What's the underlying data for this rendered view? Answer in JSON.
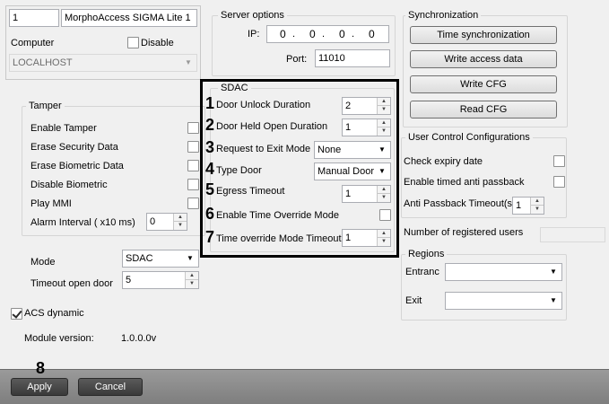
{
  "device": {
    "number": "1",
    "name": "MorphoAccess SIGMA Lite 1",
    "computer_label": "Computer",
    "disable_label": "Disable",
    "computer_value": "LOCALHOST"
  },
  "server": {
    "title": "Server options",
    "ip_label": "IP:",
    "ip_octets": [
      "0",
      "0",
      "0",
      "0"
    ],
    "port_label": "Port:",
    "port_value": "11010"
  },
  "sync": {
    "title": "Synchronization",
    "buttons": [
      "Time synchronization",
      "Write access data",
      "Write CFG",
      "Read CFG"
    ]
  },
  "tamper": {
    "title": "Tamper",
    "items": [
      "Enable Tamper",
      "Erase Security Data",
      "Erase Biometric Data",
      "Disable Biometric",
      "Play MMI"
    ],
    "alarm_label": "Alarm Interval ( x10 ms)",
    "alarm_value": "0"
  },
  "sdac": {
    "title": "SDAC",
    "door_unlock_label": "Door Unlock Duration",
    "door_unlock_value": "2",
    "door_held_label": "Door Held Open Duration",
    "door_held_value": "1",
    "rte_label": "Request to Exit Mode",
    "rte_value": "None",
    "type_door_label": "Type Door",
    "type_door_value": "Manual Door",
    "egress_label": "Egress Timeout",
    "egress_value": "1",
    "time_override_label": "Enable Time Override Mode",
    "override_timeout_label": "Time override Mode Timeout",
    "override_timeout_value": "1"
  },
  "numbers": [
    "1",
    "2",
    "3",
    "4",
    "5",
    "6",
    "7",
    "8"
  ],
  "ucc": {
    "title": "User Control Configurations",
    "check_expiry": "Check expiry date",
    "timed_anti": "Enable timed anti passback",
    "anti_timeout_label": "Anti Passback Timeout(s)",
    "anti_timeout_value": "1"
  },
  "registered_users_label": "Number of registered users",
  "regions": {
    "title": "Regions",
    "entrance_label": "Entranc",
    "exit_label": "Exit"
  },
  "mode": {
    "mode_label": "Mode",
    "mode_value": "SDAC",
    "timeout_label": "Timeout open door",
    "timeout_value": "5"
  },
  "acs_dynamic_label": "ACS dynamic",
  "module_version_label": "Module version:",
  "module_version_value": "1.0.0.0v",
  "footer": {
    "apply": "Apply",
    "cancel": "Cancel"
  }
}
